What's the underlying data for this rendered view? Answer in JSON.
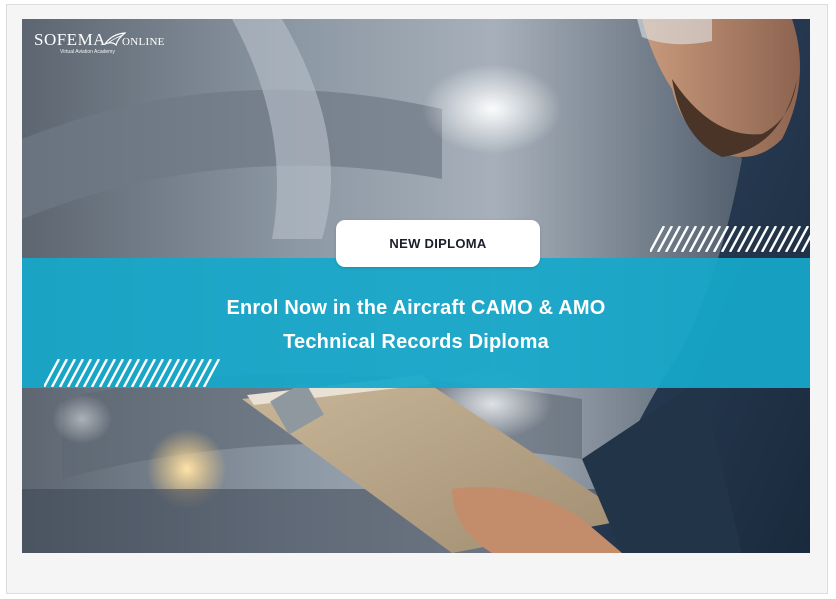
{
  "logo": {
    "brand_main": "SOFEMA",
    "brand_second": "ONLINE",
    "tagline": "Virtual Aviation Academy"
  },
  "badge": {
    "label": "NEW DIPLOMA"
  },
  "headline": {
    "line1": "Enrol Now in the Aircraft CAMO & AMO",
    "line2": "Technical Records Diploma"
  },
  "colors": {
    "teal_band": "#16a8ca",
    "badge_bg": "#ffffff",
    "text_white": "#ffffff",
    "frame_bg": "#f5f5f6"
  },
  "icons": {
    "logo_mark": "paper-plane-wing-icon",
    "decor_stripes": "diagonal-hatch-icon"
  }
}
